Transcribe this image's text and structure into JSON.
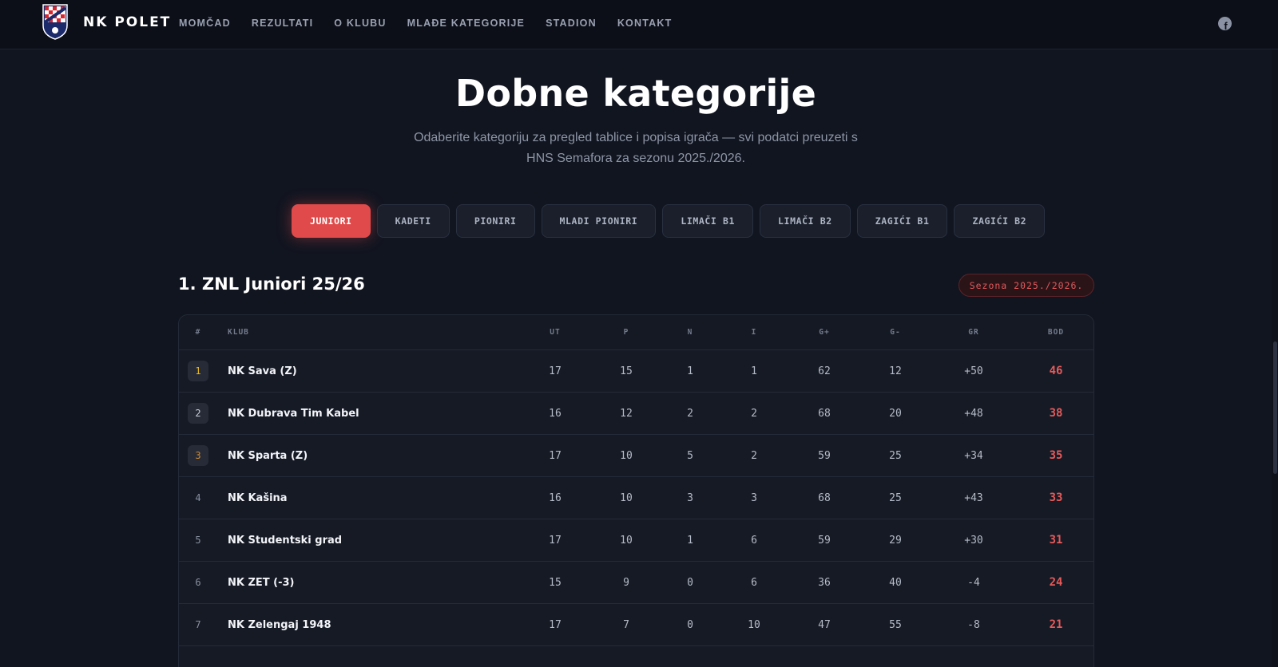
{
  "header": {
    "brand": "NK POLET",
    "nav": [
      "MOMČAD",
      "REZULTATI",
      "O KLUBU",
      "MLAĐE KATEGORIJE",
      "STADION",
      "KONTAKT"
    ],
    "logo_text": "NK POLET"
  },
  "hero": {
    "title": "Dobne kategorije",
    "subtitle_line1": "Odaberite kategoriju za pregled tablice i popisa igrača — svi podatci preuzeti s",
    "subtitle_line2": "HNS Semafora za sezonu 2025./2026."
  },
  "tabs": [
    "JUNIORI",
    "KADETI",
    "PIONIRI",
    "MLADI PIONIRI",
    "LIMAČI B1",
    "LIMAČI B2",
    "ZAGIĆI B1",
    "ZAGIĆI B2"
  ],
  "active_tab": "JUNIORI",
  "section": {
    "title": "1. ZNL Juniori 25/26",
    "season": "Sezona 2025./2026."
  },
  "table": {
    "columns": [
      "#",
      "KLUB",
      "UT",
      "P",
      "N",
      "I",
      "G+",
      "G-",
      "GR",
      "BOD"
    ],
    "rows": [
      [
        "1",
        "NK Sava (Z)",
        "17",
        "15",
        "1",
        "1",
        "62",
        "12",
        "+50",
        "46"
      ],
      [
        "2",
        "NK Dubrava Tim Kabel",
        "16",
        "12",
        "2",
        "2",
        "68",
        "20",
        "+48",
        "38"
      ],
      [
        "3",
        "NK Sparta (Z)",
        "17",
        "10",
        "5",
        "2",
        "59",
        "25",
        "+34",
        "35"
      ],
      [
        "4",
        "NK Kašina",
        "16",
        "10",
        "3",
        "3",
        "68",
        "25",
        "+43",
        "33"
      ],
      [
        "5",
        "NK Studentski grad",
        "17",
        "10",
        "1",
        "6",
        "59",
        "29",
        "+30",
        "31"
      ],
      [
        "6",
        "NK ZET (-3)",
        "15",
        "9",
        "0",
        "6",
        "36",
        "40",
        "-4",
        "24"
      ],
      [
        "7",
        "NK Zelengaj 1948",
        "17",
        "7",
        "0",
        "10",
        "47",
        "55",
        "-8",
        "21"
      ]
    ]
  },
  "colors": {
    "accent": "#e04a4a",
    "gold": "#e8b923",
    "silver": "#c9ced8",
    "bronze": "#c98a3a",
    "background": "#111520"
  },
  "icons": {
    "social": "facebook-icon"
  }
}
